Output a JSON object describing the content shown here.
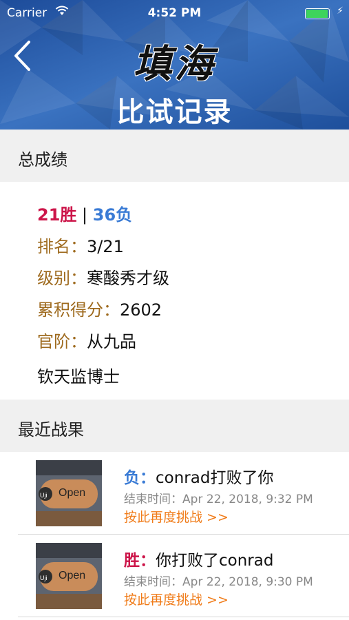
{
  "status": {
    "carrier": "Carrier",
    "time": "4:52 PM"
  },
  "header": {
    "logo_text": "填海",
    "title": "比试记录"
  },
  "summary": {
    "heading": "总成绩",
    "wins": "21胜",
    "sep": " | ",
    "losses": "36负",
    "rank_label": "排名：",
    "rank_value": "3/21",
    "level_label": "级别：",
    "level_value": "寒酸秀才级",
    "score_label": "累积得分：",
    "score_value": "2602",
    "grade_label": "官阶：",
    "grade_value": "从九品",
    "title_line": "钦天监博士"
  },
  "recent": {
    "heading": "最近战果",
    "items": [
      {
        "result": "负",
        "sep": "：",
        "text": "conrad打败了你",
        "time_label": "结束时间：",
        "time": "Apr 22, 2018, 9:32 PM",
        "action": "按此再度挑战 >>",
        "thumb_sign": "Open",
        "thumb_brand": "Uji"
      },
      {
        "result": "胜",
        "sep": "：",
        "text": "你打败了conrad",
        "time_label": "结束时间：",
        "time": "Apr 22, 2018, 9:30 PM",
        "action": "按此再度挑战 >>",
        "thumb_sign": "Open",
        "thumb_brand": "Uji"
      }
    ]
  },
  "colors": {
    "win": "#cc1549",
    "loss": "#3a7bd5",
    "label": "#9e6a1e",
    "link": "#f07c1a"
  }
}
